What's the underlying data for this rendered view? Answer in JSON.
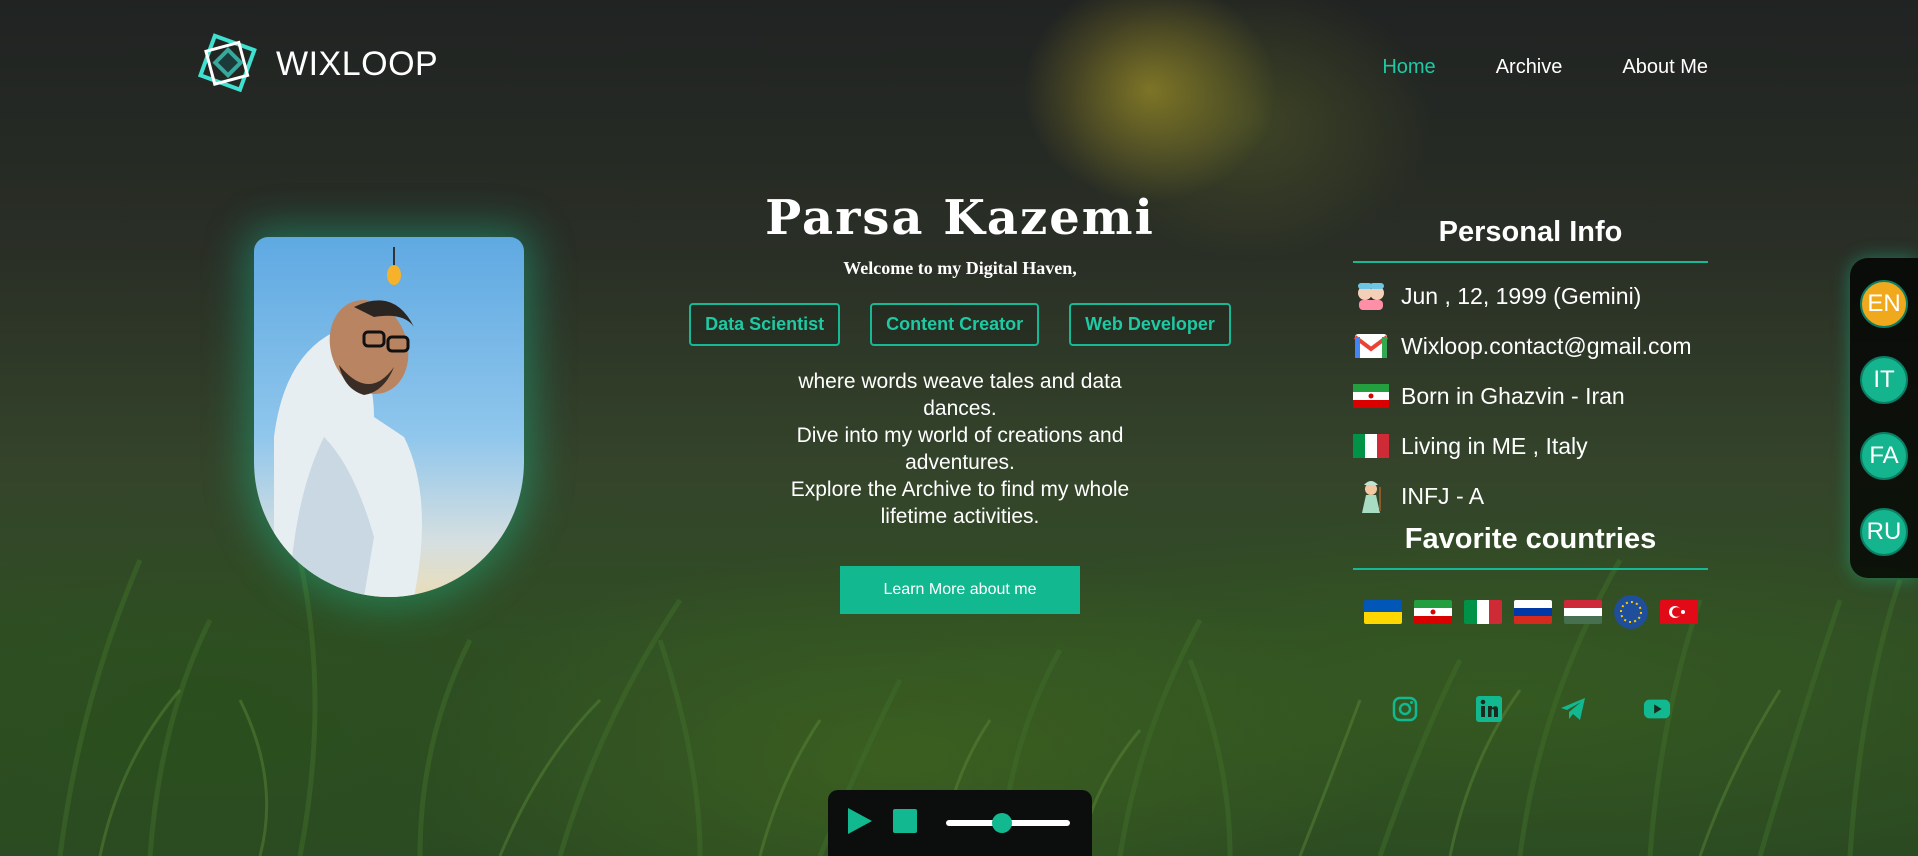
{
  "brand": {
    "name": "WIXLOOP",
    "accent": "#1ec9a4"
  },
  "nav": {
    "items": [
      {
        "label": "Home",
        "active": true
      },
      {
        "label": "Archive",
        "active": false
      },
      {
        "label": "About Me",
        "active": false
      }
    ]
  },
  "hero": {
    "name": "Parsa Kazemi",
    "welcome": "Welcome to my Digital Haven,",
    "roles": [
      "Data Scientist",
      "Content Creator",
      "Web Developer"
    ],
    "tagline": [
      "where words weave tales and data dances.",
      "Dive into my world of creations and adventures.",
      "Explore the Archive to find my whole lifetime activities."
    ],
    "cta": "Learn More about me"
  },
  "personal_info": {
    "title": "Personal Info",
    "rows": [
      {
        "icon": "gemini-twins-icon",
        "text": "Jun , 12, 1999 (Gemini)"
      },
      {
        "icon": "gmail-icon",
        "text": "Wixloop.contact@gmail.com"
      },
      {
        "icon": "iran-flag-icon",
        "text": "Born in Ghazvin - Iran"
      },
      {
        "icon": "italy-flag-icon",
        "text": "Living in ME , Italy"
      },
      {
        "icon": "mage-icon",
        "text": "INFJ - A"
      }
    ]
  },
  "favorite_countries": {
    "title": "Favorite countries",
    "flags": [
      "ukraine-flag-icon",
      "iran-flag-icon",
      "italy-flag-icon",
      "russia-flag-icon",
      "hungary-flag-icon",
      "eu-flag-icon",
      "turkey-flag-icon"
    ]
  },
  "socials": [
    "instagram-icon",
    "linkedin-icon",
    "telegram-icon",
    "youtube-icon"
  ],
  "languages": [
    {
      "code": "EN",
      "active": true
    },
    {
      "code": "IT",
      "active": false
    },
    {
      "code": "FA",
      "active": false
    },
    {
      "code": "RU",
      "active": false
    }
  ],
  "player": {
    "volume": 0.45
  }
}
